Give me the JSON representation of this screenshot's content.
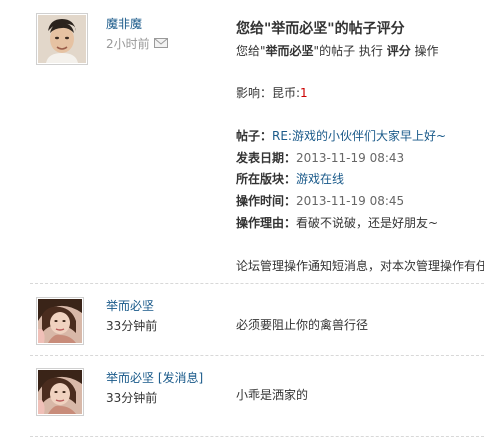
{
  "post1": {
    "username": "魔非魔",
    "time": "2小时前",
    "title": "您给\"举而必坚\"的帖子评分",
    "line1_a": "您给\"",
    "line1_name": "举而必坚",
    "line1_b": "\"的帖子 执行 ",
    "line1_action": "评分",
    "line1_c": " 操作",
    "influence_label": "影响：昆币:",
    "influence_value": "1",
    "thread_label": "帖子：",
    "thread_link": "RE:游戏的小伙伴们大家早上好~",
    "posted_label": "发表日期：",
    "posted_value": "2013-11-19 08:43",
    "forum_label": "所在版块：",
    "forum_link": "游戏在线",
    "optime_label": "操作时间：",
    "optime_value": "2013-11-19 08:45",
    "reason_label": "操作理由：",
    "reason_value": "看破不说破，还是好朋友~",
    "footer": "论坛管理操作通知短消息，对本次管理操作有任"
  },
  "post2": {
    "username": "举而必坚",
    "time": "33分钟前",
    "message": "必须要阻止你的禽兽行径"
  },
  "post3": {
    "username": "举而必坚",
    "tag": "[发消息]",
    "time": "33分钟前",
    "message": "小乖是洒家的"
  },
  "icons": {
    "mail": "mail-icon",
    "avatar1": "avatar-man",
    "avatar2": "avatar-woman"
  }
}
